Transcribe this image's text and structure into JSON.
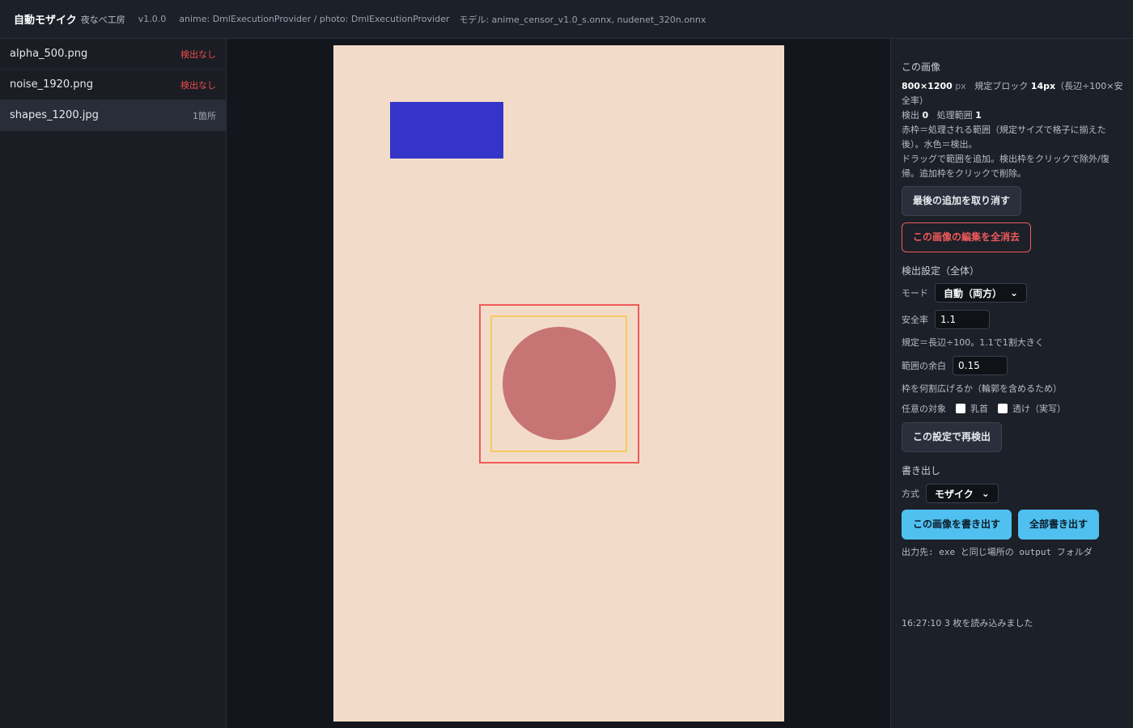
{
  "header": {
    "title": "自動モザイク",
    "subtitle": "夜なべ工房",
    "version": "v1.0.0",
    "providers": "anime: DmlExecutionProvider / photo: DmlExecutionProvider",
    "models": "モデル: anime_censor_v1.0_s.onnx, nudenet_320n.onnx"
  },
  "files": [
    {
      "name": "alpha_500.png",
      "status": "検出なし",
      "selected": false
    },
    {
      "name": "noise_1920.png",
      "status": "検出なし",
      "selected": false
    },
    {
      "name": "shapes_1200.jpg",
      "status": "1箇所",
      "selected": true
    }
  ],
  "image_info": {
    "section_title": "この画像",
    "size": "800×1200",
    "size_unit": "px",
    "block_label": "規定ブロック",
    "block_value": "14px",
    "block_note": "（長辺÷100×安全率）",
    "detect_label": "検出",
    "detect_value": "0",
    "range_label": "処理範囲",
    "range_value": "1",
    "help1": "赤枠＝処理される範囲（規定サイズで格子に揃えた後）。水色＝検出。",
    "help2": "ドラッグで範囲を追加。検出枠をクリックで除外/復帰。追加枠をクリックで削除。"
  },
  "buttons": {
    "undo_add": "最後の追加を取り消す",
    "clear_edits": "この画像の編集を全消去",
    "redetect": "この設定で再検出",
    "export_this": "この画像を書き出す",
    "export_all": "全部書き出す"
  },
  "detect_settings": {
    "title": "検出設定（全体）",
    "mode_label": "モード",
    "mode_value": "自動（両方）",
    "safety_label": "安全率",
    "safety_value": "1.1",
    "safety_note": "規定＝長辺÷100。1.1で1割大きく",
    "margin_label": "範囲の余白",
    "margin_value": "0.15",
    "margin_note": "枠を何割広げるか（輪郭を含めるため）",
    "optional_label": "任意の対象",
    "opt1": "乳首",
    "opt2": "透け（実写）"
  },
  "export": {
    "title": "書き出し",
    "method_label": "方式",
    "method_value": "モザイク",
    "output_note": "出力先: exe と同じ場所の output フォルダ"
  },
  "log": {
    "time": "16:27:10",
    "message": "3 枚を読み込みました"
  },
  "colors": {
    "canvas_bg": "#f2dcc9",
    "blue_shape": "#3434c9",
    "red_shape": "#c77474",
    "process_box": "#ee5a5a",
    "detect_box": "#f3cb62",
    "accent": "#4fc0ef",
    "danger": "#ef5a5a"
  }
}
